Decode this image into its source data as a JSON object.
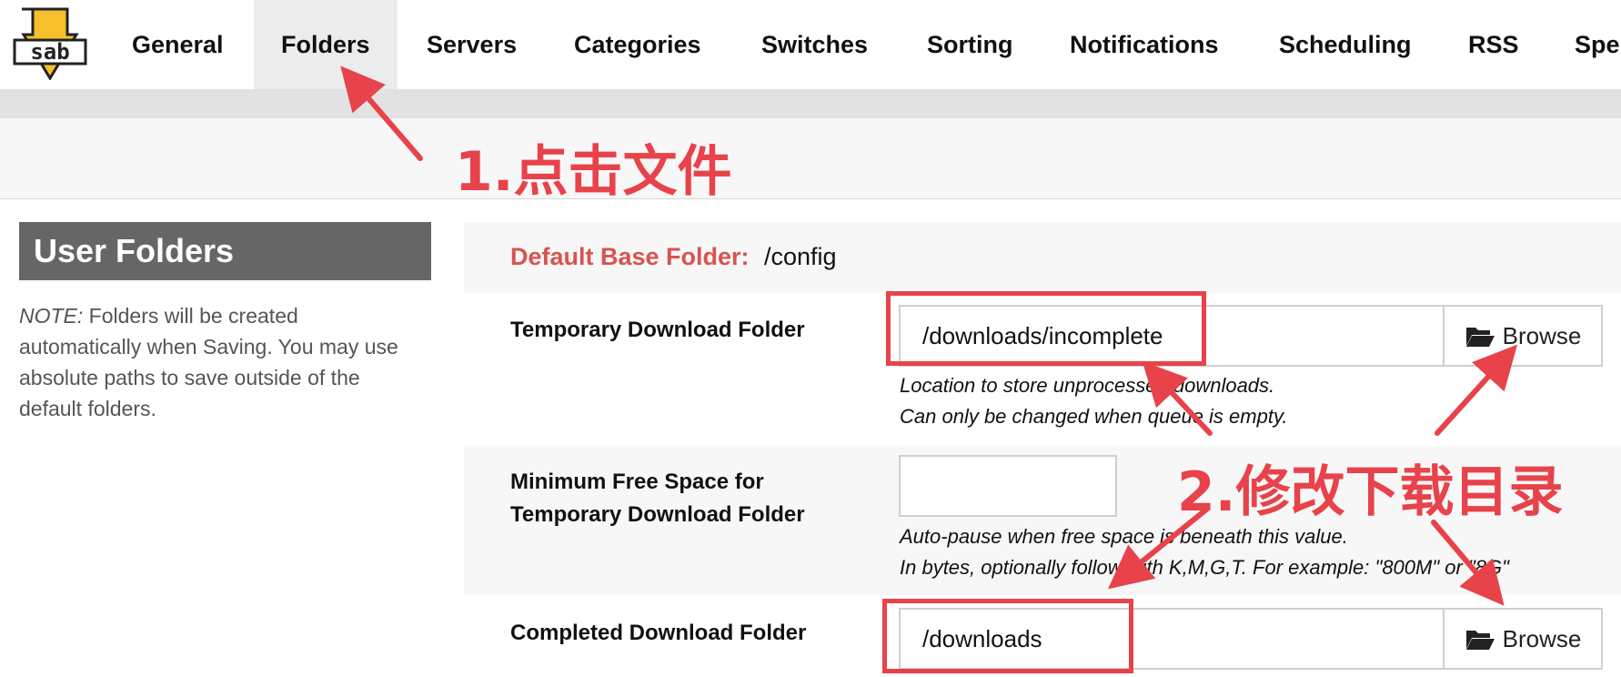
{
  "nav": {
    "logo_text": "sab",
    "tabs": [
      {
        "label": "General"
      },
      {
        "label": "Folders",
        "active": true
      },
      {
        "label": "Servers"
      },
      {
        "label": "Categories"
      },
      {
        "label": "Switches"
      },
      {
        "label": "Sorting"
      },
      {
        "label": "Notifications"
      },
      {
        "label": "Scheduling"
      },
      {
        "label": "RSS"
      },
      {
        "label": "Spe"
      }
    ]
  },
  "sidebar": {
    "title": "User Folders",
    "note_prefix": "NOTE:",
    "note_text": " Folders will be created automatically when Saving. You may use absolute paths to save outside of the default folders."
  },
  "main": {
    "base_folder_label": "Default Base Folder:",
    "base_folder_value": "/config",
    "temp_folder": {
      "label": "Temporary Download Folder",
      "value": "/downloads/incomplete",
      "browse_label": "Browse",
      "hint_line1": "Location to store unprocessed downloads.",
      "hint_line2": "Can only be changed when queue is empty."
    },
    "min_free": {
      "label_line1": "Minimum Free Space for",
      "label_line2": "Temporary Download Folder",
      "value": "",
      "hint_line1": "Auto-pause when free space is beneath this value.",
      "hint_line2": "In bytes, optionally follow with K,M,G,T. For example: \"800M\" or \"8G\""
    },
    "complete_folder": {
      "label": "Completed Download Folder",
      "value": "/downloads",
      "browse_label": "Browse"
    }
  },
  "annotations": {
    "step1": "1.点击文件",
    "step2": "2.修改下载目录",
    "color": "#e8424a"
  },
  "colors": {
    "accent_red": "#d9534f",
    "sidebar_header_bg": "#666666",
    "logo_yellow": "#f5c02c"
  }
}
